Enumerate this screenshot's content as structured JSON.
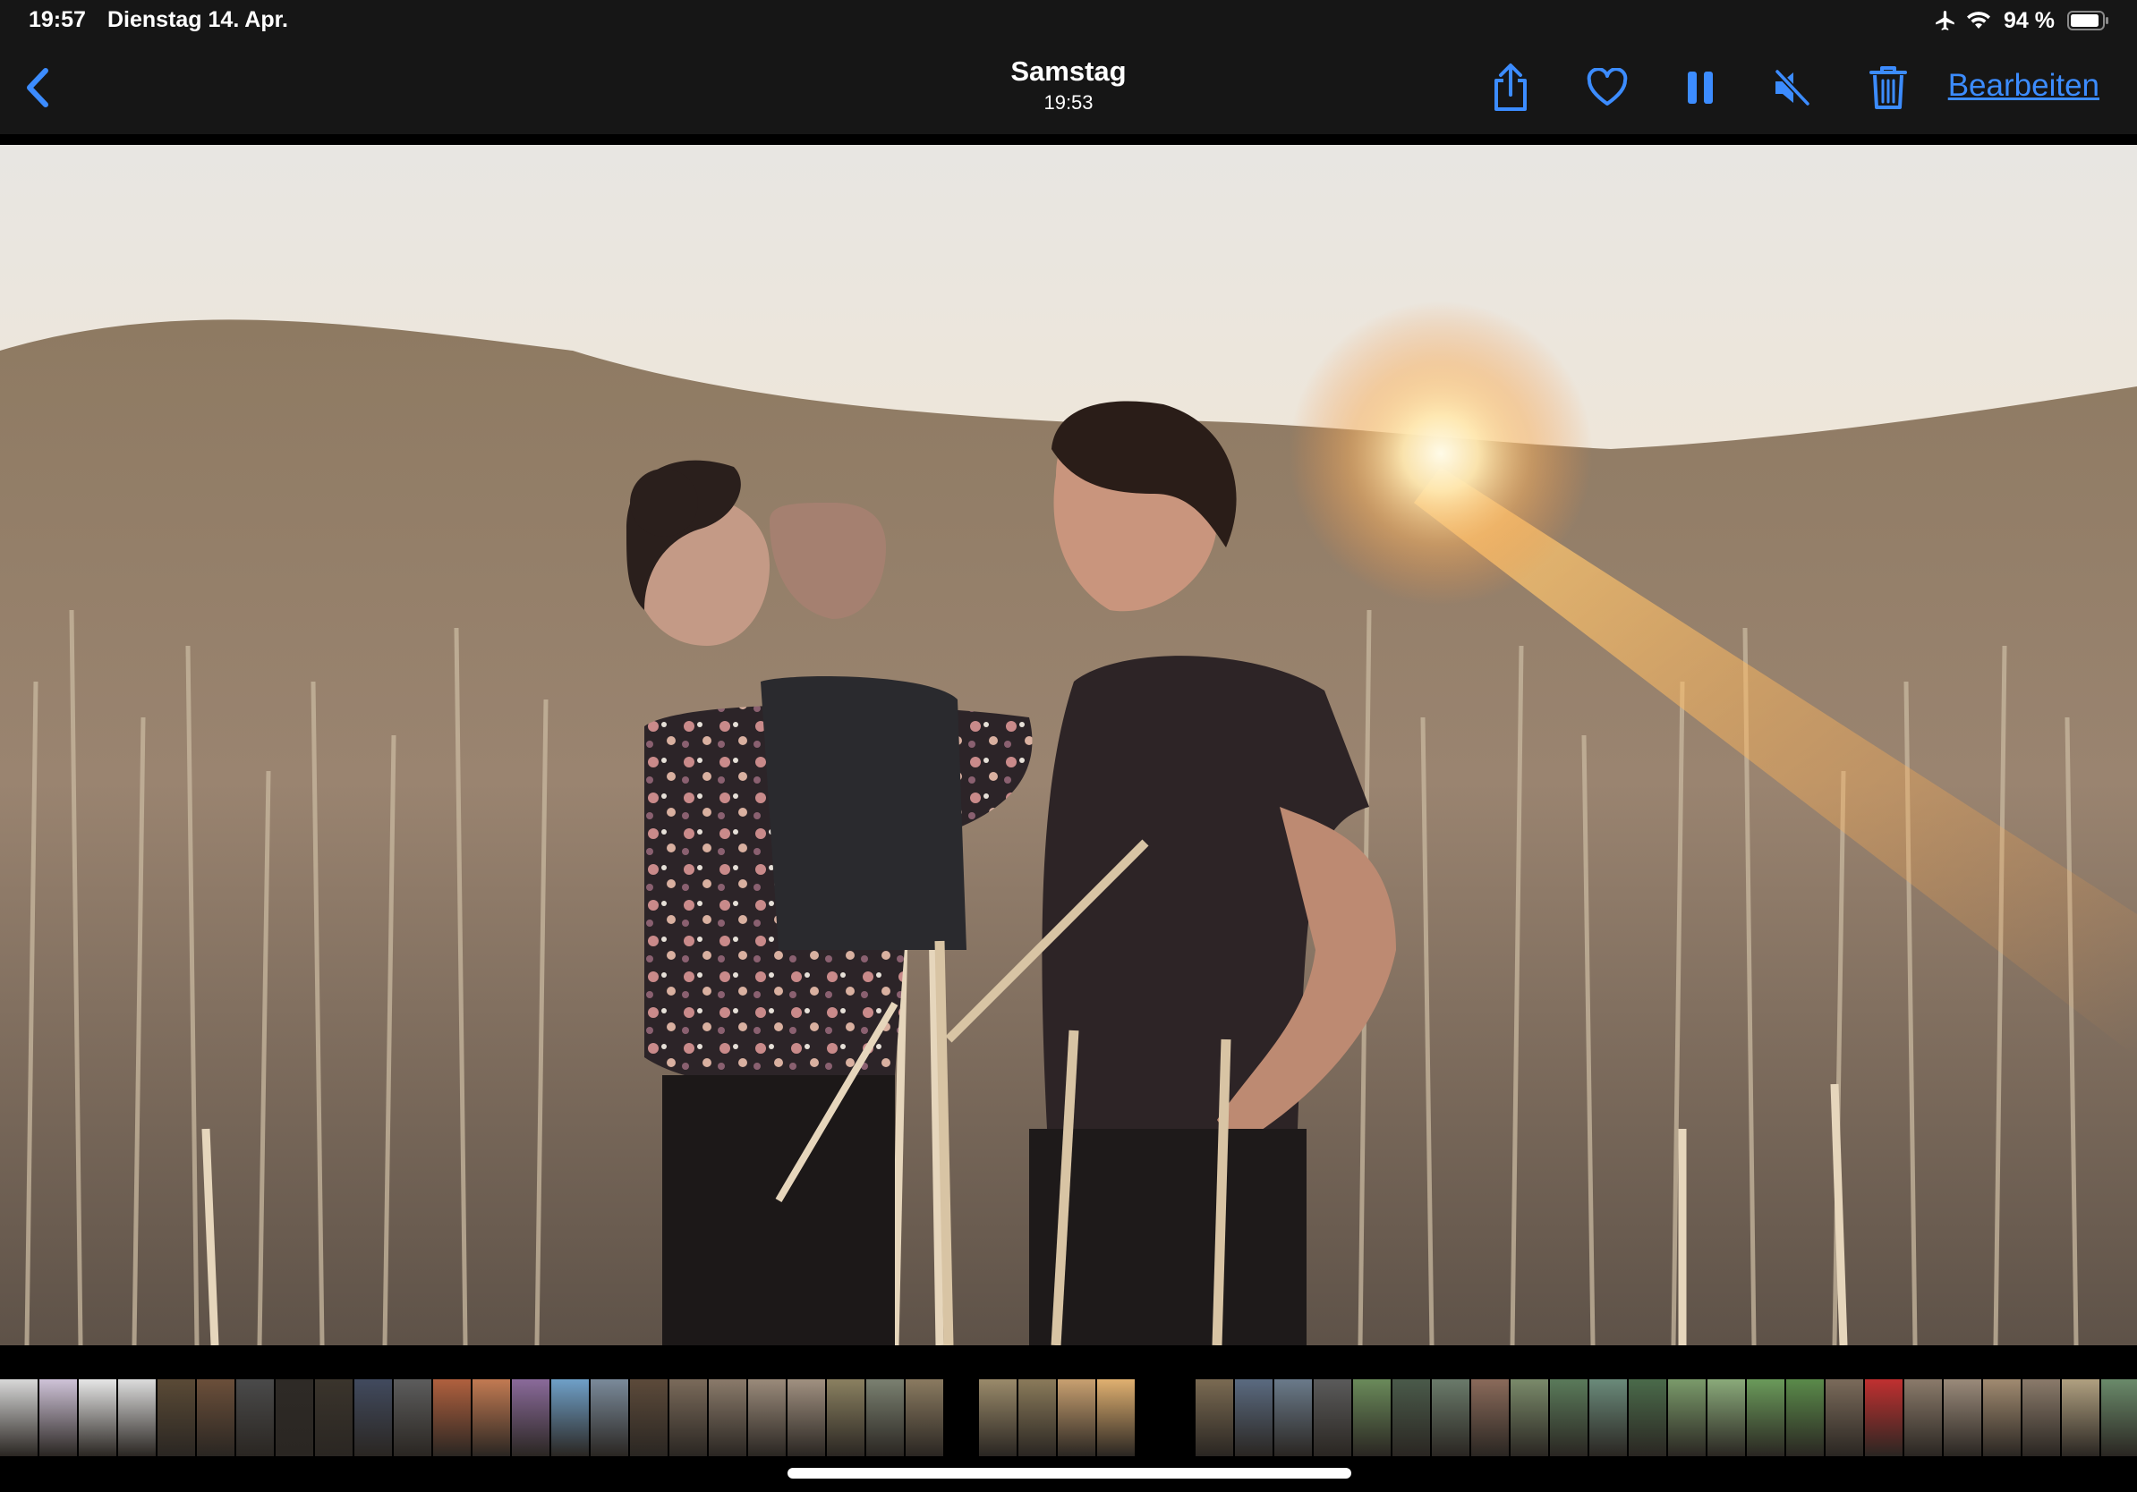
{
  "status_bar": {
    "time": "19:57",
    "date": "Dienstag 14. Apr.",
    "battery_percent": "94 %",
    "battery_level": 0.94,
    "icons": [
      "airplane-icon",
      "wifi-icon",
      "battery-icon"
    ]
  },
  "nav": {
    "title": "Samstag",
    "subtitle": "19:53",
    "edit_label": "Bearbeiten",
    "accent_color": "#3c8cff",
    "tools": [
      "back-chevron-icon",
      "share-icon",
      "heart-icon",
      "pause-icon",
      "speaker-muted-icon",
      "trash-icon"
    ]
  },
  "photo": {
    "description_icon": "photo-image"
  },
  "thumbnail_strip": {
    "groups": [
      {
        "start": 0,
        "count": 24,
        "colors": [
          "#d8d8d8",
          "#cfc3d8",
          "#e6e6e6",
          "#dcdcdc",
          "#5a4a36",
          "#6b4f3a",
          "#4a4a4a",
          "#2e2a26",
          "#3a342c",
          "#414a5e",
          "#5c5c5c",
          "#b0603e",
          "#c27a52",
          "#8a6a9a",
          "#6fa0c8",
          "#7a8a9a",
          "#5c4a3a",
          "#7a6a5a",
          "#8a7a6a",
          "#9a8a7a",
          "#a09080",
          "#8a8060",
          "#7a8070",
          "#8a7a60"
        ]
      },
      {
        "start": 1094,
        "count": 4,
        "colors": [
          "#9a8a6a",
          "#8a7a5a",
          "#c8a070",
          "#e0b070"
        ]
      },
      {
        "start": 1336,
        "count": 24,
        "colors": [
          "#7a6a52",
          "#5a6a80",
          "#6a7a8a",
          "#5a5a5a",
          "#6a8a5a",
          "#4a5a4a",
          "#6a7a6a",
          "#8a6a5a",
          "#7a8a6a",
          "#5a7a5a",
          "#6a8a7a",
          "#4a6a4a",
          "#7a9a6a",
          "#8aaa7a",
          "#6a9a5a",
          "#5a8a4a",
          "#7a6a5a",
          "#c03030",
          "#8a7a6a",
          "#9a8a7a",
          "#a08a70",
          "#8a7a6a",
          "#b0a080",
          "#6a8a6a"
        ]
      }
    ]
  }
}
